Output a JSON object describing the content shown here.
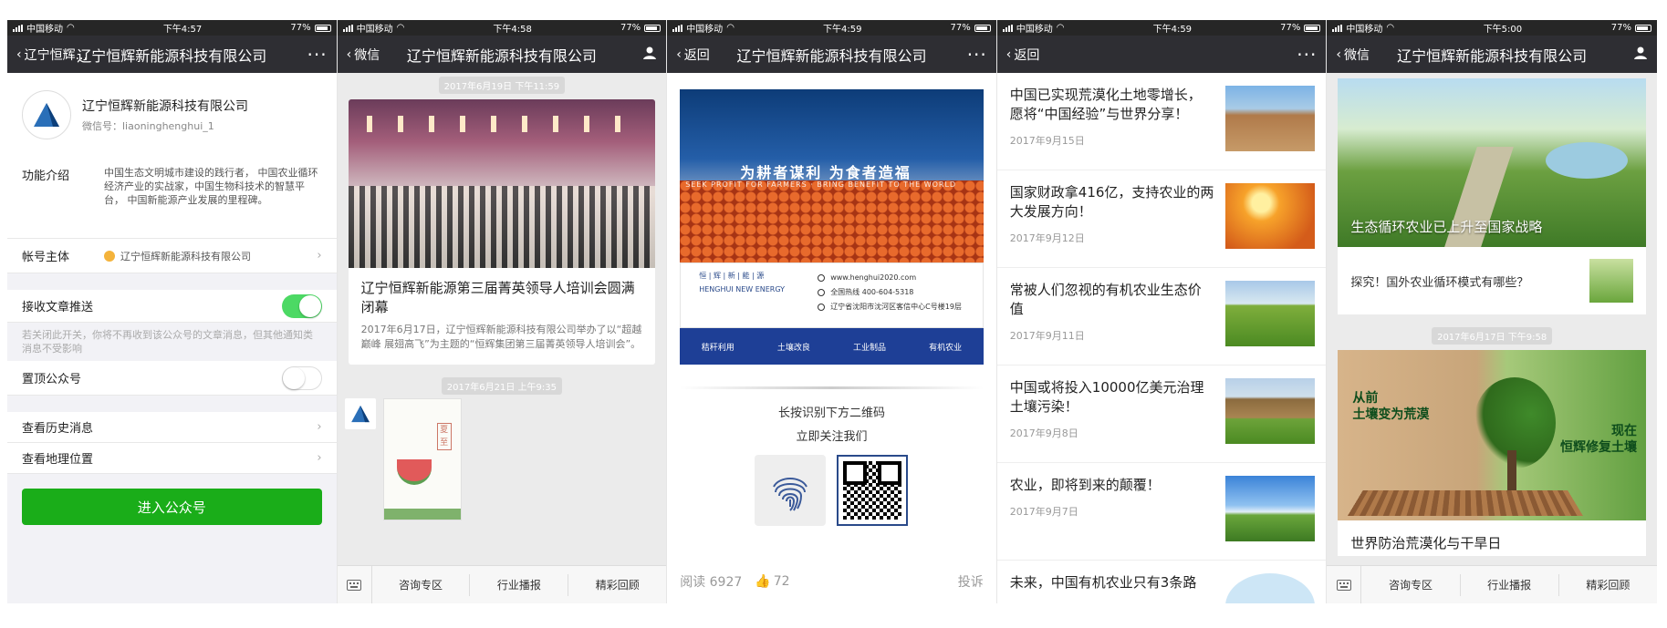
{
  "status": {
    "carrier": "中国移动",
    "battery": "77%",
    "times": [
      "下午4:57",
      "下午4:58",
      "下午4:59",
      "下午4:59",
      "下午5:00"
    ]
  },
  "screen1": {
    "nav_back": "辽宁恒辉...",
    "nav_title": "辽宁恒辉新能源科技有限公司",
    "name": "辽宁恒辉新能源科技有限公司",
    "wechat_id": "微信号：liaoninghenghui_1",
    "func_label": "功能介绍",
    "func_text": "中国生态文明城市建设的践行者， 中国农业循环经济产业的实战家，中国生物科技术的智慧平台， 中国新能源产业发展的里程碑。",
    "account_label": "帐号主体",
    "account_value": "辽宁恒辉新能源科技有限公司",
    "receive_label": "接收文章推送",
    "receive_on": true,
    "hint": "若关闭此开关，你将不再收到该公众号的文章消息，但其他通知类消息不受影响",
    "pin_label": "置顶公众号",
    "pin_on": false,
    "history_label": "查看历史消息",
    "location_label": "查看地理位置",
    "enter_button": "进入公众号"
  },
  "screen2": {
    "nav_back": "微信",
    "nav_title": "辽宁恒辉新能源科技有限公司",
    "time1": "2017年6月19日 下午11:59",
    "article_title": "辽宁恒辉新能源第三届菁英领导人培训会圆满闭幕",
    "article_summary": "2017年6月17日，辽宁恒辉新能源科技有限公司举办了以“超越巅峰 展翅高飞”为主题的“恒辉集团第三届菁英领导人培训会”。",
    "time2": "2017年6月21日 上午9:35",
    "poster_tag": "夏至",
    "menu": [
      "咨询专区",
      "行业播报",
      "精彩回顾"
    ]
  },
  "screen3": {
    "nav_back": "返回",
    "nav_title": "辽宁恒辉新能源科技有限公司",
    "slogan": "为耕者谋利  为食者造福",
    "slogan_en": "SEEK PROFIT FOR FARMERS · BRING BENEFIT TO THE WORLD",
    "brand_cn": "恒 | 辉 | 新 | 能 | 源",
    "brand_en": "HENGHUI NEW ENERGY",
    "web": "www.henghui2020.com",
    "phone": "全国热线 400-604-5318",
    "address": "辽宁省沈阳市沈河区客信中心C号楼19层",
    "features": [
      "秸秆利用",
      "土壤改良",
      "工业制品",
      "有机农业"
    ],
    "qr_line1": "长按识别下方二维码",
    "qr_line2": "立即关注我们",
    "reads": "阅读 6927",
    "likes": "72",
    "report": "投诉"
  },
  "screen4": {
    "nav_back": "返回",
    "articles": [
      {
        "title": "中国已实现荒漠化土地零增长，愿将“中国经验”与世界分享！",
        "date": "2017年9月15日"
      },
      {
        "title": "国家财政拿416亿，支持农业的两大发展方向！",
        "date": "2017年9月12日"
      },
      {
        "title": "常被人们忽视的有机农业生态价值",
        "date": "2017年9月11日"
      },
      {
        "title": "中国或将投入10000亿美元治理土壤污染！",
        "date": "2017年9月8日"
      },
      {
        "title": "农业，即将到来的颠覆！",
        "date": "2017年9月7日"
      },
      {
        "title": "未来，中国有机农业只有3条路",
        "date": ""
      }
    ]
  },
  "screen5": {
    "nav_back": "微信",
    "nav_title": "辽宁恒辉新能源科技有限公司",
    "hero_caption": "生态循环农业已上升至国家战略",
    "sub_title": "探究！国外农业循环模式有哪些？",
    "time": "2017年6月17日 下午9:58",
    "hero2_left": "从前\n土壤变为荒漠",
    "hero2_right": "现在\n恒辉修复土壤",
    "hero2_caption": "世界防治荒漠化与干旱日",
    "menu": [
      "咨询专区",
      "行业播报",
      "精彩回顾"
    ]
  },
  "icons": [
    "signal-icon",
    "wifi-icon",
    "battery-icon",
    "back-chevron-icon",
    "more-icon",
    "person-icon",
    "chevron-right-icon",
    "keyboard-icon",
    "thumb-up-icon",
    "fingerprint-icon",
    "qr-code-icon"
  ]
}
